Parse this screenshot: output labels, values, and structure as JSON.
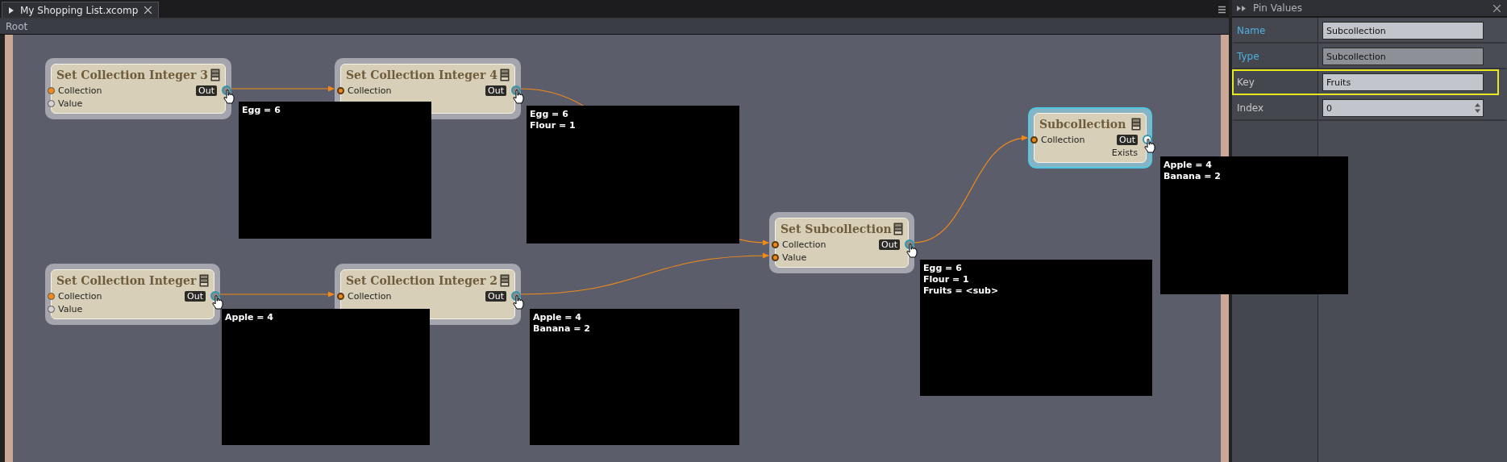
{
  "document_tab": {
    "label": "My Shopping List.xcomp"
  },
  "breadcrumb": "Root",
  "nodes": [
    {
      "title": "Set Collection Integer 3",
      "selected": false,
      "inputs": [
        {
          "label": "Collection",
          "color": "#f28a18",
          "connected": false
        },
        {
          "label": "Value",
          "color": "#d4d4d4",
          "connected": false
        }
      ],
      "outputs": [
        {
          "label": "Out",
          "kind": "badge"
        }
      ],
      "tooltip": [
        "Egg = 6"
      ]
    },
    {
      "title": "Set Collection Integer 4",
      "selected": false,
      "inputs": [
        {
          "label": "Collection",
          "color": "#f28a18",
          "connected": true
        }
      ],
      "outputs": [
        {
          "label": "Out",
          "kind": "badge"
        }
      ],
      "tooltip": [
        "Egg = 6",
        "Flour = 1"
      ]
    },
    {
      "title": "Set Collection Integer",
      "selected": false,
      "inputs": [
        {
          "label": "Collection",
          "color": "#f28a18",
          "connected": false
        },
        {
          "label": "Value",
          "color": "#d4d4d4",
          "connected": false
        }
      ],
      "outputs": [
        {
          "label": "Out",
          "kind": "badge"
        }
      ],
      "tooltip": [
        "Apple = 4"
      ]
    },
    {
      "title": "Set Collection Integer 2",
      "selected": false,
      "inputs": [
        {
          "label": "Collection",
          "color": "#f28a18",
          "connected": true
        }
      ],
      "outputs": [
        {
          "label": "Out",
          "kind": "badge"
        }
      ],
      "tooltip": [
        "Apple = 4",
        "Banana = 2"
      ]
    },
    {
      "title": "Set Subcollection",
      "selected": false,
      "inputs": [
        {
          "label": "Collection",
          "color": "#f28a18",
          "connected": true
        },
        {
          "label": "Value",
          "color": "#f28a18",
          "connected": true
        }
      ],
      "outputs": [
        {
          "label": "Out",
          "kind": "badge"
        }
      ],
      "tooltip": [
        "Egg = 6",
        "Flour = 1",
        "Fruits = <sub>"
      ]
    },
    {
      "title": "Subcollection",
      "selected": true,
      "inputs": [
        {
          "label": "Collection",
          "color": "#f28a18",
          "connected": true
        }
      ],
      "outputs": [
        {
          "label": "Out",
          "kind": "badge"
        },
        {
          "label": "Exists",
          "kind": "plain"
        }
      ],
      "tooltip": [
        "Apple = 4",
        "Banana = 2"
      ]
    }
  ],
  "panel": {
    "title": "Pin Values",
    "rows": [
      {
        "label": "Name",
        "value": "Subcollection",
        "kind": "text",
        "linked": true,
        "disabled": false,
        "highlighted": false
      },
      {
        "label": "Type",
        "value": "Subcollection",
        "kind": "text",
        "linked": true,
        "disabled": true,
        "highlighted": false
      },
      {
        "label": "Key",
        "value": "Fruits",
        "kind": "text",
        "linked": false,
        "disabled": false,
        "highlighted": true
      },
      {
        "label": "Index",
        "value": "0",
        "kind": "spinner",
        "linked": false,
        "disabled": false,
        "highlighted": false
      }
    ]
  }
}
